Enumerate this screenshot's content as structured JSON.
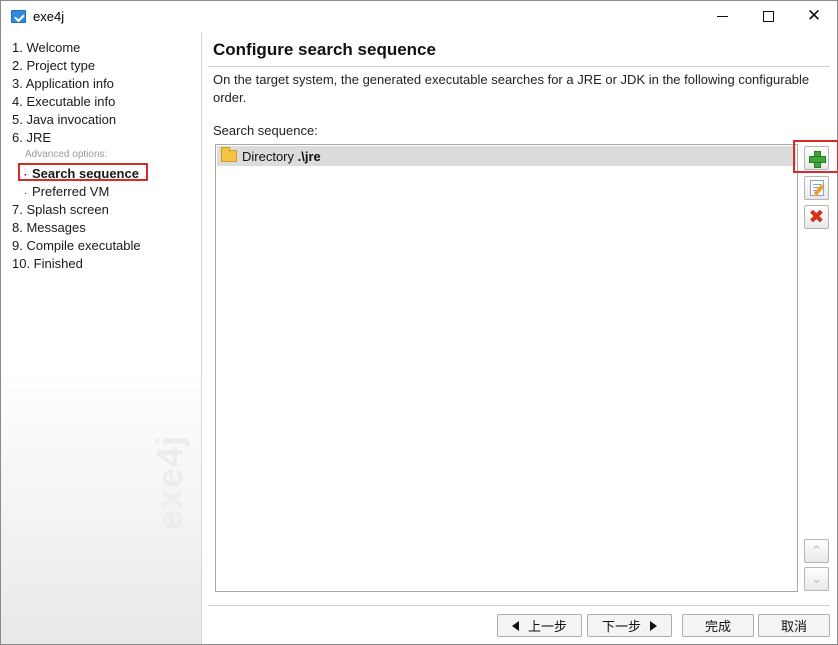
{
  "window": {
    "title": "exe4j"
  },
  "nav": {
    "items": [
      {
        "label": "1. Welcome"
      },
      {
        "label": "2. Project type"
      },
      {
        "label": "3. Application info"
      },
      {
        "label": "4. Executable info"
      },
      {
        "label": "5. Java invocation"
      },
      {
        "label": "6. JRE"
      },
      {
        "label": "7. Splash screen"
      },
      {
        "label": "8. Messages"
      },
      {
        "label": "9. Compile executable"
      },
      {
        "label": "10. Finished"
      }
    ],
    "advanced_hint": "Advanced options:",
    "sub_items": [
      {
        "label": "Search sequence"
      },
      {
        "label": "Preferred VM"
      }
    ],
    "bullet": "·",
    "watermark": "exe4j"
  },
  "main": {
    "title": "Configure search sequence",
    "description": "On the target system, the generated executable searches for a JRE or JDK in the following configurable order.",
    "sequence_label": "Search sequence:",
    "entries": [
      {
        "kind": "Directory",
        "path": ".\\jre"
      }
    ]
  },
  "side_buttons": {
    "down_glyph": "⌄",
    "up_glyph": "⌃",
    "delete_glyph": "✖"
  },
  "footer": {
    "back": "上一步",
    "next": "下一步",
    "finish": "完成",
    "cancel": "取消"
  },
  "colors": {
    "highlight": "#d42b2b",
    "selected_row": "#dcdcdc"
  }
}
